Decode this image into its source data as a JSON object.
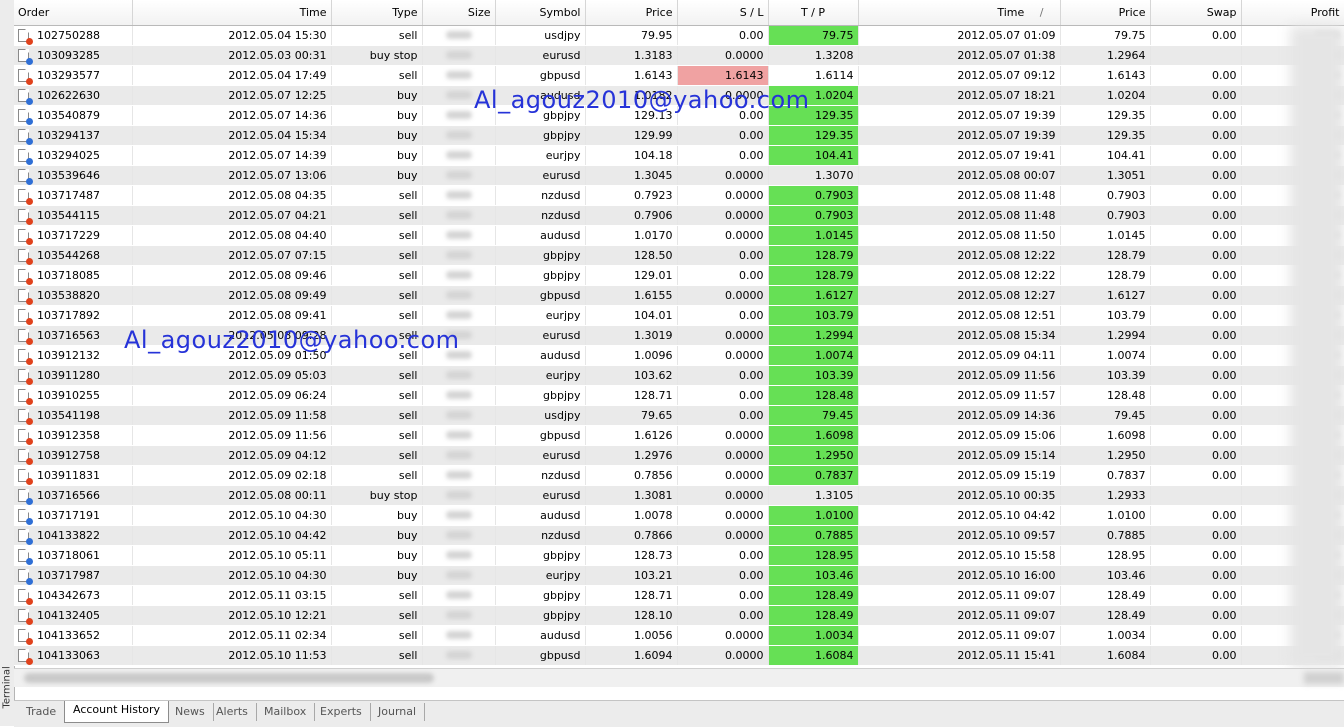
{
  "panel": {
    "side_label": "Terminal"
  },
  "columns": {
    "order": "Order",
    "time": "Time",
    "type": "Type",
    "size": "Size",
    "symbol": "Symbol",
    "price": "Price",
    "sl": "S / L",
    "tp": "T / P",
    "close_time": "Time",
    "sort_indicator": "/",
    "close_price": "Price",
    "swap": "Swap",
    "profit": "Profit"
  },
  "colors": {
    "tp_hit": "#66e055",
    "sl_hit": "#f0a2a2",
    "watermark": "#2633d8"
  },
  "rows": [
    {
      "order": "102750288",
      "time": "2012.05.04 15:30",
      "type": "sell",
      "symbol": "usdjpy",
      "price": "79.95",
      "sl": "0.00",
      "tp": "79.75",
      "close_time": "2012.05.07 01:09",
      "close_price": "79.75",
      "swap": "0.00",
      "hit": "tp"
    },
    {
      "order": "103093285",
      "time": "2012.05.03 00:31",
      "type": "buy stop",
      "symbol": "eurusd",
      "price": "1.3183",
      "sl": "0.0000",
      "tp": "1.3208",
      "close_time": "2012.05.07 01:38",
      "close_price": "1.2964",
      "swap": "",
      "hit": ""
    },
    {
      "order": "103293577",
      "time": "2012.05.04 17:49",
      "type": "sell",
      "symbol": "gbpusd",
      "price": "1.6143",
      "sl": "1.6143",
      "tp": "1.6114",
      "close_time": "2012.05.07 09:12",
      "close_price": "1.6143",
      "swap": "0.00",
      "hit": "sl"
    },
    {
      "order": "102622630",
      "time": "2012.05.07 12:25",
      "type": "buy",
      "symbol": "audusd",
      "price": "1.0182",
      "sl": "0.0000",
      "tp": "1.0204",
      "close_time": "2012.05.07 18:21",
      "close_price": "1.0204",
      "swap": "0.00",
      "hit": "tp"
    },
    {
      "order": "103540879",
      "time": "2012.05.07 14:36",
      "type": "buy",
      "symbol": "gbpjpy",
      "price": "129.13",
      "sl": "0.00",
      "tp": "129.35",
      "close_time": "2012.05.07 19:39",
      "close_price": "129.35",
      "swap": "0.00",
      "hit": "tp"
    },
    {
      "order": "103294137",
      "time": "2012.05.04 15:34",
      "type": "buy",
      "symbol": "gbpjpy",
      "price": "129.99",
      "sl": "0.00",
      "tp": "129.35",
      "close_time": "2012.05.07 19:39",
      "close_price": "129.35",
      "swap": "0.00",
      "hit": "tp"
    },
    {
      "order": "103294025",
      "time": "2012.05.07 14:39",
      "type": "buy",
      "symbol": "eurjpy",
      "price": "104.18",
      "sl": "0.00",
      "tp": "104.41",
      "close_time": "2012.05.07 19:41",
      "close_price": "104.41",
      "swap": "0.00",
      "hit": "tp"
    },
    {
      "order": "103539646",
      "time": "2012.05.07 13:06",
      "type": "buy",
      "symbol": "eurusd",
      "price": "1.3045",
      "sl": "0.0000",
      "tp": "1.3070",
      "close_time": "2012.05.08 00:07",
      "close_price": "1.3051",
      "swap": "0.00",
      "hit": ""
    },
    {
      "order": "103717487",
      "time": "2012.05.08 04:35",
      "type": "sell",
      "symbol": "nzdusd",
      "price": "0.7923",
      "sl": "0.0000",
      "tp": "0.7903",
      "close_time": "2012.05.08 11:48",
      "close_price": "0.7903",
      "swap": "0.00",
      "hit": "tp"
    },
    {
      "order": "103544115",
      "time": "2012.05.07 04:21",
      "type": "sell",
      "symbol": "nzdusd",
      "price": "0.7906",
      "sl": "0.0000",
      "tp": "0.7903",
      "close_time": "2012.05.08 11:48",
      "close_price": "0.7903",
      "swap": "0.00",
      "hit": "tp"
    },
    {
      "order": "103717229",
      "time": "2012.05.08 04:40",
      "type": "sell",
      "symbol": "audusd",
      "price": "1.0170",
      "sl": "0.0000",
      "tp": "1.0145",
      "close_time": "2012.05.08 11:50",
      "close_price": "1.0145",
      "swap": "0.00",
      "hit": "tp"
    },
    {
      "order": "103544268",
      "time": "2012.05.07 07:15",
      "type": "sell",
      "symbol": "gbpjpy",
      "price": "128.50",
      "sl": "0.00",
      "tp": "128.79",
      "close_time": "2012.05.08 12:22",
      "close_price": "128.79",
      "swap": "0.00",
      "hit": "tp"
    },
    {
      "order": "103718085",
      "time": "2012.05.08 09:46",
      "type": "sell",
      "symbol": "gbpjpy",
      "price": "129.01",
      "sl": "0.00",
      "tp": "128.79",
      "close_time": "2012.05.08 12:22",
      "close_price": "128.79",
      "swap": "0.00",
      "hit": "tp"
    },
    {
      "order": "103538820",
      "time": "2012.05.08 09:49",
      "type": "sell",
      "symbol": "gbpusd",
      "price": "1.6155",
      "sl": "0.0000",
      "tp": "1.6127",
      "close_time": "2012.05.08 12:27",
      "close_price": "1.6127",
      "swap": "0.00",
      "hit": "tp"
    },
    {
      "order": "103717892",
      "time": "2012.05.08 09:41",
      "type": "sell",
      "symbol": "eurjpy",
      "price": "104.01",
      "sl": "0.00",
      "tp": "103.79",
      "close_time": "2012.05.08 12:51",
      "close_price": "103.79",
      "swap": "0.00",
      "hit": "tp"
    },
    {
      "order": "103716563",
      "time": "2012.05.08 09:28",
      "type": "sell",
      "symbol": "eurusd",
      "price": "1.3019",
      "sl": "0.0000",
      "tp": "1.2994",
      "close_time": "2012.05.08 15:34",
      "close_price": "1.2994",
      "swap": "0.00",
      "hit": "tp"
    },
    {
      "order": "103912132",
      "time": "2012.05.09 01:50",
      "type": "sell",
      "symbol": "audusd",
      "price": "1.0096",
      "sl": "0.0000",
      "tp": "1.0074",
      "close_time": "2012.05.09 04:11",
      "close_price": "1.0074",
      "swap": "0.00",
      "hit": "tp"
    },
    {
      "order": "103911280",
      "time": "2012.05.09 05:03",
      "type": "sell",
      "symbol": "eurjpy",
      "price": "103.62",
      "sl": "0.00",
      "tp": "103.39",
      "close_time": "2012.05.09 11:56",
      "close_price": "103.39",
      "swap": "0.00",
      "hit": "tp"
    },
    {
      "order": "103910255",
      "time": "2012.05.09 06:24",
      "type": "sell",
      "symbol": "gbpjpy",
      "price": "128.71",
      "sl": "0.00",
      "tp": "128.48",
      "close_time": "2012.05.09 11:57",
      "close_price": "128.48",
      "swap": "0.00",
      "hit": "tp"
    },
    {
      "order": "103541198",
      "time": "2012.05.09 11:58",
      "type": "sell",
      "symbol": "usdjpy",
      "price": "79.65",
      "sl": "0.00",
      "tp": "79.45",
      "close_time": "2012.05.09 14:36",
      "close_price": "79.45",
      "swap": "0.00",
      "hit": "tp"
    },
    {
      "order": "103912358",
      "time": "2012.05.09 11:56",
      "type": "sell",
      "symbol": "gbpusd",
      "price": "1.6126",
      "sl": "0.0000",
      "tp": "1.6098",
      "close_time": "2012.05.09 15:06",
      "close_price": "1.6098",
      "swap": "0.00",
      "hit": "tp"
    },
    {
      "order": "103912758",
      "time": "2012.05.09 04:12",
      "type": "sell",
      "symbol": "eurusd",
      "price": "1.2976",
      "sl": "0.0000",
      "tp": "1.2950",
      "close_time": "2012.05.09 15:14",
      "close_price": "1.2950",
      "swap": "0.00",
      "hit": "tp"
    },
    {
      "order": "103911831",
      "time": "2012.05.09 02:18",
      "type": "sell",
      "symbol": "nzdusd",
      "price": "0.7856",
      "sl": "0.0000",
      "tp": "0.7837",
      "close_time": "2012.05.09 15:19",
      "close_price": "0.7837",
      "swap": "0.00",
      "hit": "tp"
    },
    {
      "order": "103716566",
      "time": "2012.05.08 00:11",
      "type": "buy stop",
      "symbol": "eurusd",
      "price": "1.3081",
      "sl": "0.0000",
      "tp": "1.3105",
      "close_time": "2012.05.10 00:35",
      "close_price": "1.2933",
      "swap": "",
      "hit": ""
    },
    {
      "order": "103717191",
      "time": "2012.05.10 04:30",
      "type": "buy",
      "symbol": "audusd",
      "price": "1.0078",
      "sl": "0.0000",
      "tp": "1.0100",
      "close_time": "2012.05.10 04:42",
      "close_price": "1.0100",
      "swap": "0.00",
      "hit": "tp"
    },
    {
      "order": "104133822",
      "time": "2012.05.10 04:42",
      "type": "buy",
      "symbol": "nzdusd",
      "price": "0.7866",
      "sl": "0.0000",
      "tp": "0.7885",
      "close_time": "2012.05.10 09:57",
      "close_price": "0.7885",
      "swap": "0.00",
      "hit": "tp"
    },
    {
      "order": "103718061",
      "time": "2012.05.10 05:11",
      "type": "buy",
      "symbol": "gbpjpy",
      "price": "128.73",
      "sl": "0.00",
      "tp": "128.95",
      "close_time": "2012.05.10 15:58",
      "close_price": "128.95",
      "swap": "0.00",
      "hit": "tp"
    },
    {
      "order": "103717987",
      "time": "2012.05.10 04:30",
      "type": "buy",
      "symbol": "eurjpy",
      "price": "103.21",
      "sl": "0.00",
      "tp": "103.46",
      "close_time": "2012.05.10 16:00",
      "close_price": "103.46",
      "swap": "0.00",
      "hit": "tp"
    },
    {
      "order": "104342673",
      "time": "2012.05.11 03:15",
      "type": "sell",
      "symbol": "gbpjpy",
      "price": "128.71",
      "sl": "0.00",
      "tp": "128.49",
      "close_time": "2012.05.11 09:07",
      "close_price": "128.49",
      "swap": "0.00",
      "hit": "tp"
    },
    {
      "order": "104132405",
      "time": "2012.05.10 12:21",
      "type": "sell",
      "symbol": "gbpjpy",
      "price": "128.10",
      "sl": "0.00",
      "tp": "128.49",
      "close_time": "2012.05.11 09:07",
      "close_price": "128.49",
      "swap": "0.00",
      "hit": "tp"
    },
    {
      "order": "104133652",
      "time": "2012.05.11 02:34",
      "type": "sell",
      "symbol": "audusd",
      "price": "1.0056",
      "sl": "0.0000",
      "tp": "1.0034",
      "close_time": "2012.05.11 09:07",
      "close_price": "1.0034",
      "swap": "0.00",
      "hit": "tp"
    },
    {
      "order": "104133063",
      "time": "2012.05.10 11:53",
      "type": "sell",
      "symbol": "gbpusd",
      "price": "1.6094",
      "sl": "0.0000",
      "tp": "1.6084",
      "close_time": "2012.05.11 15:41",
      "close_price": "1.6084",
      "swap": "0.00",
      "hit": "tp"
    }
  ],
  "watermarks": [
    {
      "text": "Al_agouz2010@yahoo.com"
    },
    {
      "text": "Al_agouz2010@yahoo.com"
    }
  ],
  "tabs": [
    {
      "label": "Trade",
      "active": false
    },
    {
      "label": "Account History",
      "active": true
    },
    {
      "label": "News",
      "active": false
    },
    {
      "label": "Alerts",
      "active": false
    },
    {
      "label": "Mailbox",
      "active": false
    },
    {
      "label": "Experts",
      "active": false
    },
    {
      "label": "Journal",
      "active": false
    }
  ]
}
